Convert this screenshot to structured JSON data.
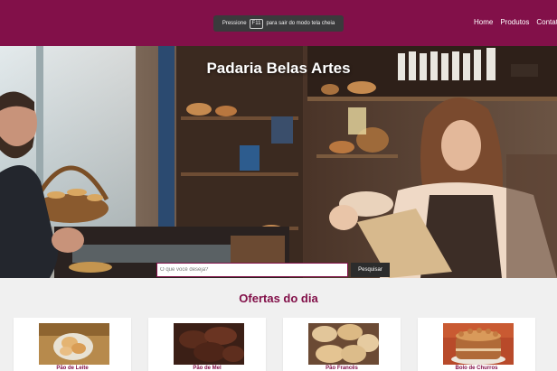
{
  "fullscreen_toast": {
    "prefix": "Pressione",
    "key": "F11",
    "suffix": "para sair do modo tela cheia"
  },
  "nav": {
    "items": [
      "Home",
      "Produtos",
      "Contato"
    ]
  },
  "hero": {
    "title": "Padaria Belas Artes"
  },
  "search": {
    "placeholder": "O que você deseja?",
    "value": "",
    "button_label": "Pesquisar"
  },
  "offers": {
    "title": "Ofertas do dia",
    "products": [
      {
        "name": "Pão de Leite"
      },
      {
        "name": "Pão de Mel"
      },
      {
        "name": "Pão Francês"
      },
      {
        "name": "Bolo de Churros"
      }
    ]
  },
  "colors": {
    "brand": "#821049",
    "button_dark": "#2c2c2c",
    "background": "#f0f0f0"
  }
}
